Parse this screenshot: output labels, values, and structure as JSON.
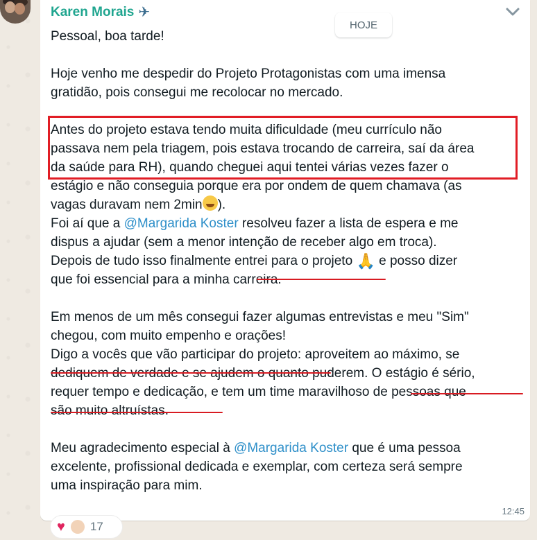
{
  "sender": {
    "name": "Karen Morais",
    "icon": "airplane-icon"
  },
  "date_separator": "HOJE",
  "message": {
    "lines": [
      "Pessoal, boa tarde!",
      "",
      "Hoje venho me despedir do Projeto Protagonistas com uma imensa",
      "gratidão, pois consegui me recolocar no mercado.",
      "",
      "Antes do projeto estava tendo muita dificuldade (meu currículo não",
      "passava nem pela triagem, pois estava trocando de carreira, saí da área",
      "da saúde para RH), quando cheguei aqui tentei várias vezes fazer o",
      "estágio e não conseguia porque era por ondem de quem chamava (as",
      "vagas duravam nem 2min",
      "). ",
      "Foi aí que a ",
      "@Margarida Koster",
      "  resolveu fazer a lista de espera e me",
      "dispus a ajudar (sem a menor intenção de receber algo em troca).",
      "Depois de tudo isso finalmente entrei para o projeto ",
      " e posso dizer",
      "que foi essencial para a minha carreira.",
      "",
      "Em menos de um mês consegui fazer algumas entrevistas e meu \"Sim\"",
      "chegou, com muito empenho e orações!",
      "Digo a vocês que vão participar do projeto: aproveitem ao máximo, se",
      "dediquem de verdade e se ajudem o quanto puderem. O estágio é sério,",
      "requer tempo e dedicação, e tem um time maravilhoso de pessoas que",
      "são muito altruístas.",
      "",
      "Meu agradecimento especial à ",
      "@Margarida Koster",
      " que é uma pessoa",
      "excelente, profissional dedicada e exemplar, com certeza será sempre",
      "uma inspiração para mim."
    ],
    "time": "12:45"
  },
  "reactions": {
    "items": [
      "heart",
      "clapping-hands"
    ],
    "count": "17"
  },
  "colors": {
    "sender": "#1fa58f",
    "mention": "#2e8fc9",
    "annotation": "#e11d25",
    "background": "#efeae2"
  }
}
